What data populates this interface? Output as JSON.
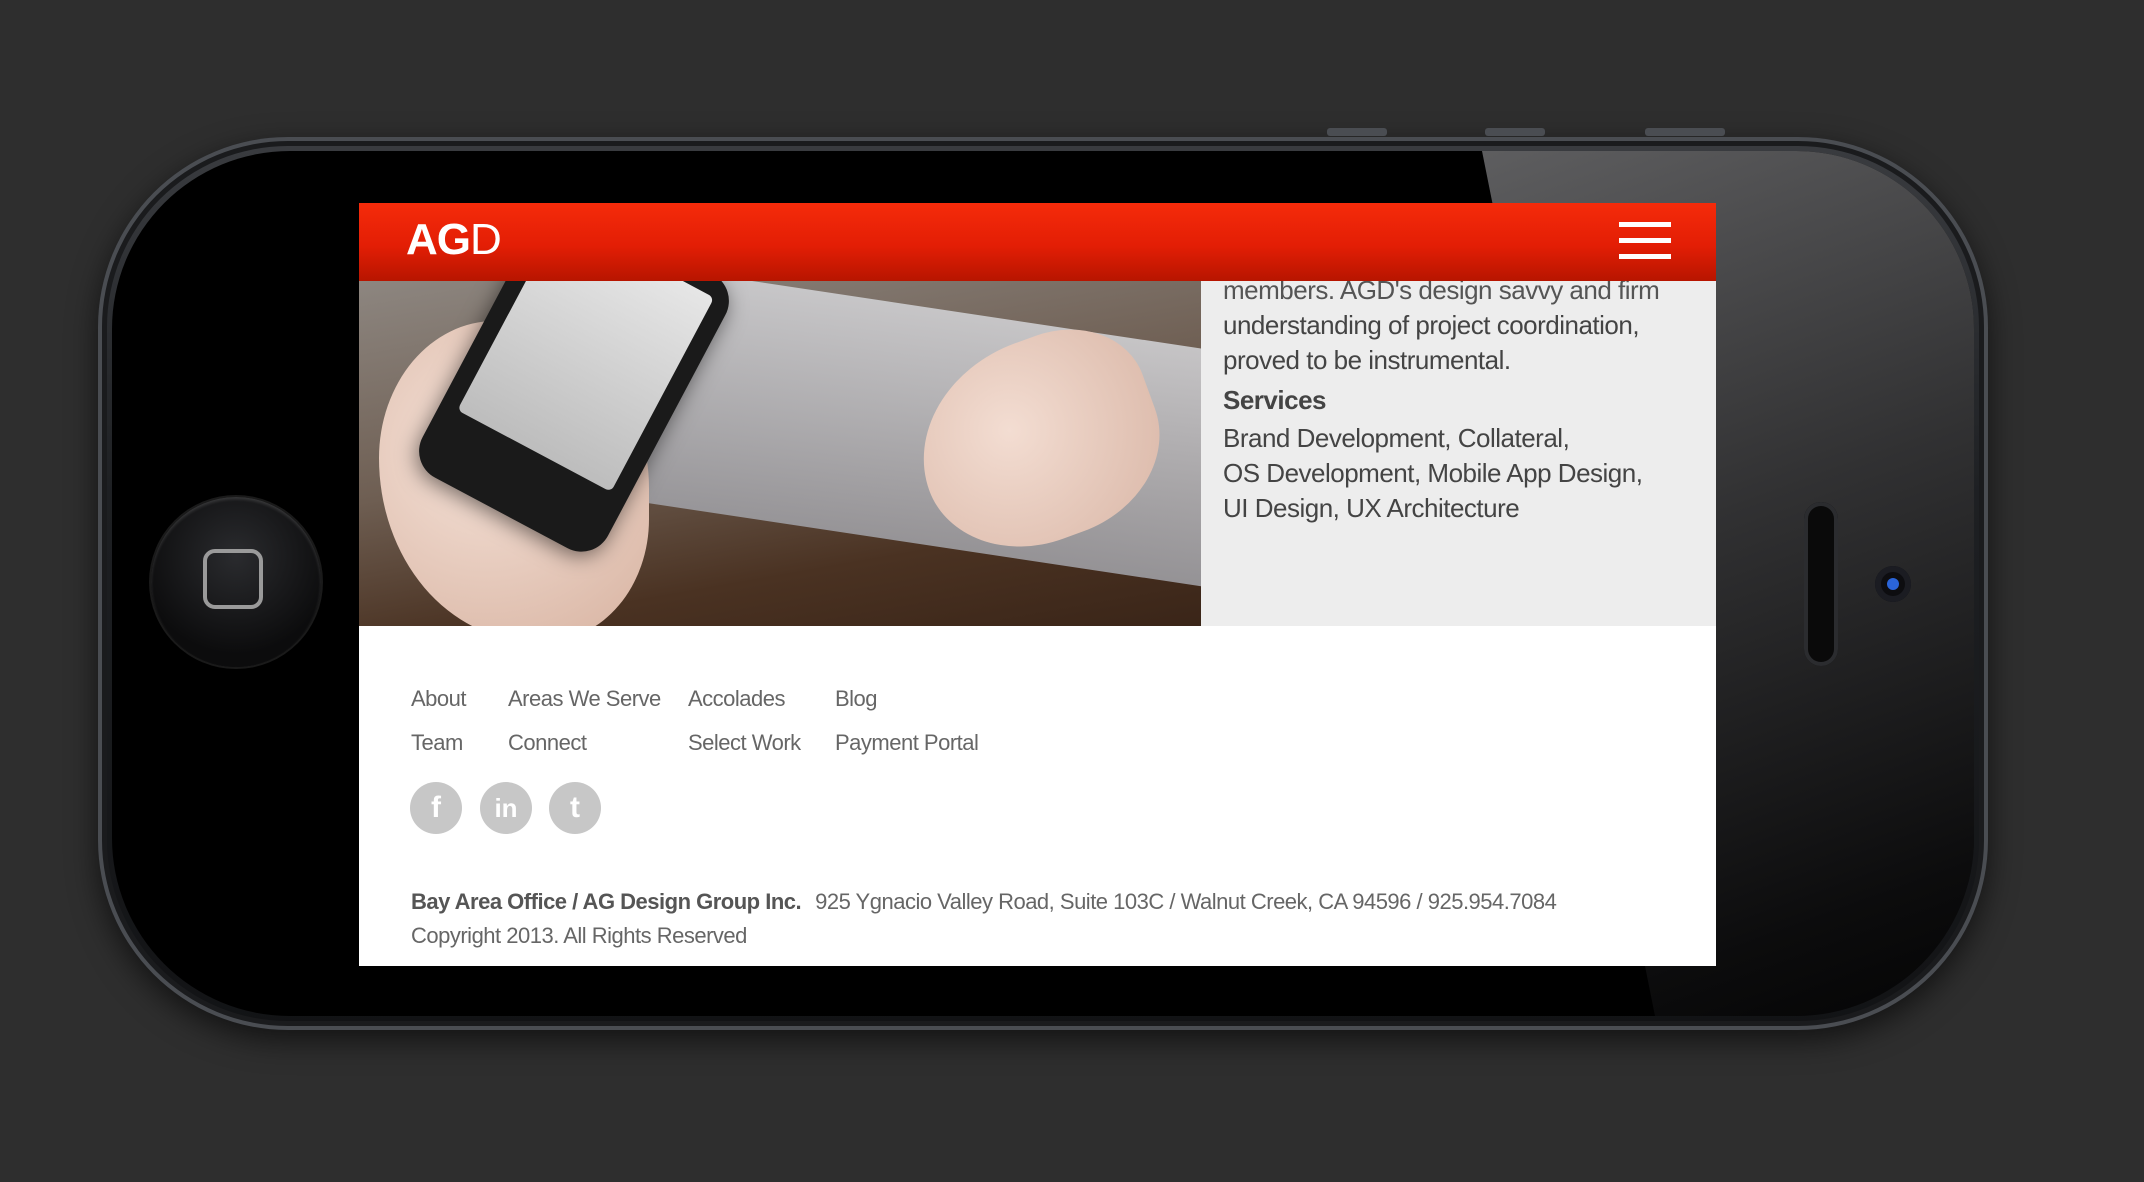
{
  "header": {
    "logo_bold": "AG",
    "logo_thin": "D"
  },
  "panel": {
    "partial_line": "members. AGD's design savvy and firm",
    "line2": "understanding of project coordination,",
    "line3": "proved to be instrumental.",
    "services_title": "Services",
    "services": [
      "Brand Development,  Collateral,",
      "OS Development,  Mobile App Design,",
      "UI Design,  UX Architecture"
    ]
  },
  "footer": {
    "nav": [
      {
        "label": "About"
      },
      {
        "label": "Areas We Serve"
      },
      {
        "label": "Accolades"
      },
      {
        "label": "Blog"
      },
      {
        "label": "Team"
      },
      {
        "label": "Connect"
      },
      {
        "label": "Select Work"
      },
      {
        "label": "Payment Portal"
      }
    ],
    "social": [
      {
        "icon": "facebook-icon",
        "glyph": "f"
      },
      {
        "icon": "linkedin-icon",
        "glyph": "in"
      },
      {
        "icon": "twitter-icon",
        "glyph": "t"
      }
    ],
    "office": "Bay Area Office / AG Design Group Inc.",
    "address": "925 Ygnacio Valley Road, Suite 103C /  Walnut Creek, CA 94596 / 925.954.7084",
    "copyright": "Copyright 2013. All Rights Reserved"
  },
  "colors": {
    "brand_red": "#e31e05",
    "panel_bg": "#ededed",
    "background": "#2e2e2e"
  }
}
